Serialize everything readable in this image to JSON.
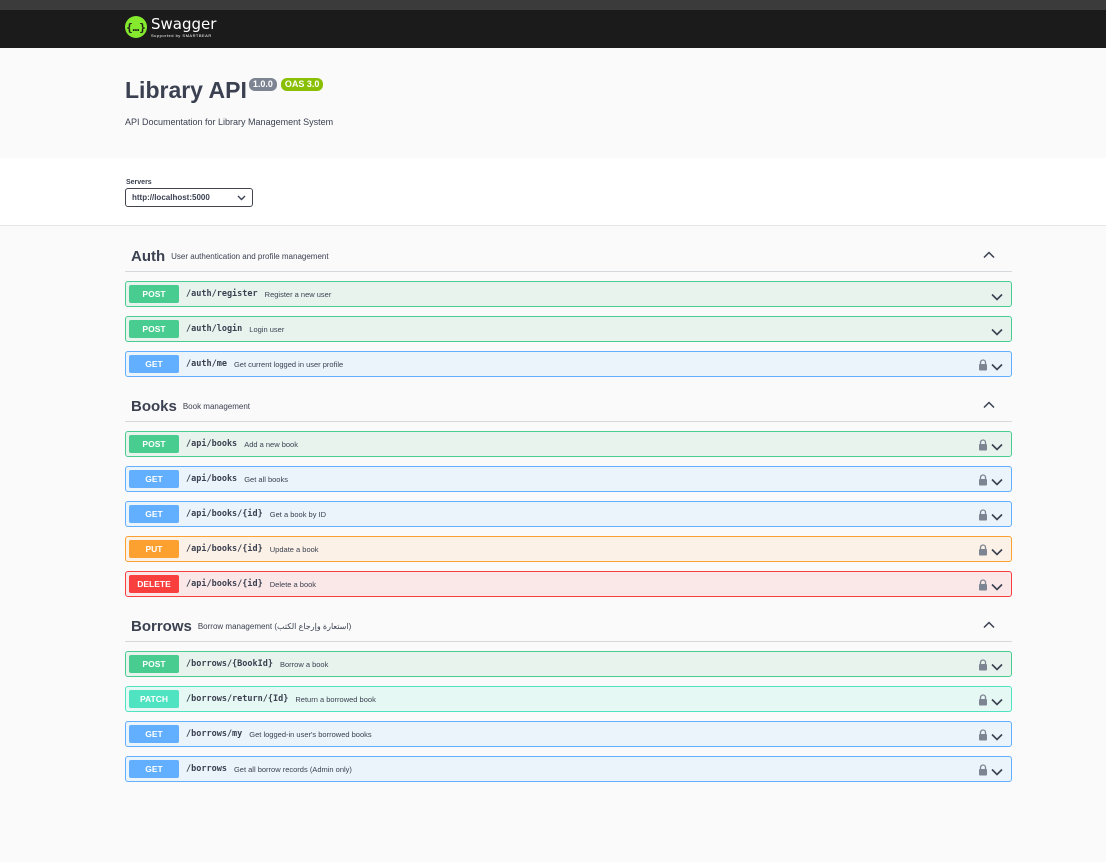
{
  "header": {
    "brand": "Swagger",
    "brand_sub": "Supported by SMARTBEAR"
  },
  "info": {
    "title": "Library API",
    "version": "1.0.0",
    "oas": "OAS 3.0",
    "description": "API Documentation for Library Management System"
  },
  "servers": {
    "label": "Servers",
    "selected": "http://localhost:5000"
  },
  "tags": [
    {
      "name": "Auth",
      "description": "User authentication and profile management",
      "operations": [
        {
          "method": "POST",
          "path": "/auth/register",
          "summary": "Register a new user",
          "locked": false
        },
        {
          "method": "POST",
          "path": "/auth/login",
          "summary": "Login user",
          "locked": false
        },
        {
          "method": "GET",
          "path": "/auth/me",
          "summary": "Get current logged in user profile",
          "locked": true
        }
      ]
    },
    {
      "name": "Books",
      "description": "Book management",
      "operations": [
        {
          "method": "POST",
          "path": "/api/books",
          "summary": "Add a new book",
          "locked": true
        },
        {
          "method": "GET",
          "path": "/api/books",
          "summary": "Get all books",
          "locked": true
        },
        {
          "method": "GET",
          "path": "/api/books/{id}",
          "summary": "Get a book by ID",
          "locked": true
        },
        {
          "method": "PUT",
          "path": "/api/books/{id}",
          "summary": "Update a book",
          "locked": true
        },
        {
          "method": "DELETE",
          "path": "/api/books/{id}",
          "summary": "Delete a book",
          "locked": true
        }
      ]
    },
    {
      "name": "Borrows",
      "description": "Borrow management (استعارة وإرجاع الكتب)",
      "operations": [
        {
          "method": "POST",
          "path": "/borrows/{BookId}",
          "summary": "Borrow a book",
          "locked": true
        },
        {
          "method": "PATCH",
          "path": "/borrows/return/{Id}",
          "summary": "Return a borrowed book",
          "locked": true
        },
        {
          "method": "GET",
          "path": "/borrows/my",
          "summary": "Get logged-in user's borrowed books",
          "locked": true
        },
        {
          "method": "GET",
          "path": "/borrows",
          "summary": "Get all borrow records (Admin only)",
          "locked": true
        }
      ]
    }
  ],
  "colors": {
    "post": "#49cc90",
    "get": "#61affe",
    "put": "#fca130",
    "delete": "#f93e3e",
    "patch": "#50e3c2",
    "brand": "#85ea2d",
    "topbar": "#1b1b1b"
  }
}
